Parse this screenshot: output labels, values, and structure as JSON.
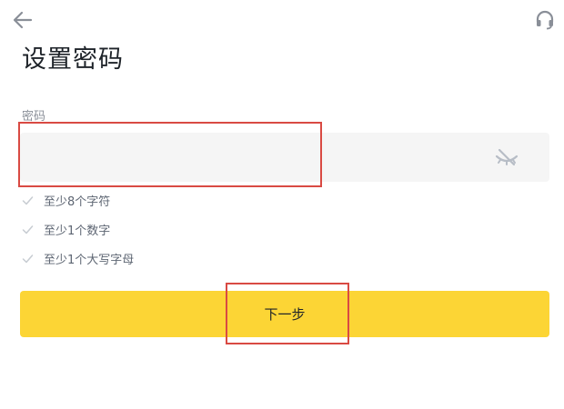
{
  "header": {
    "back_icon": "arrow-left-icon",
    "support_icon": "headset-icon"
  },
  "page": {
    "title": "设置密码"
  },
  "form": {
    "password_label": "密码",
    "password_value": "",
    "visibility_icon": "eye-off-icon"
  },
  "rules": [
    {
      "text": "至少8个字符",
      "icon": "check-icon"
    },
    {
      "text": "至少1个数字",
      "icon": "check-icon"
    },
    {
      "text": "至少1个大写字母",
      "icon": "check-icon"
    }
  ],
  "actions": {
    "next_label": "下一步"
  },
  "colors": {
    "accent": "#fcd535",
    "text": "#1e2329",
    "muted": "#8a8f98",
    "input_bg": "#f5f5f5",
    "annotation": "#d94a43"
  }
}
